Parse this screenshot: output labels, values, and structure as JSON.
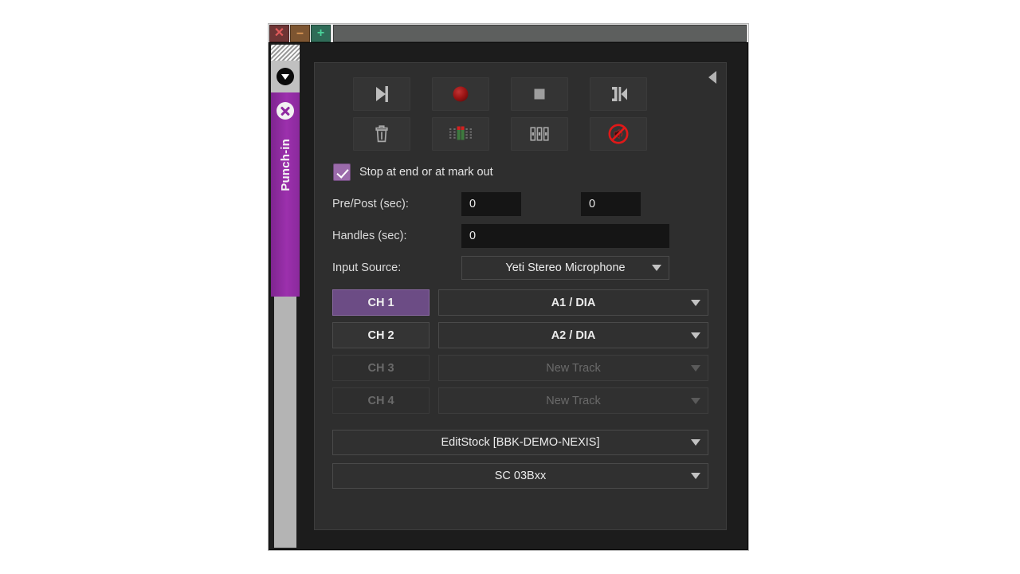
{
  "window": {
    "titlebar": {
      "close_label": "✕",
      "minimize_label": "–",
      "maximize_label": "+"
    }
  },
  "rail": {
    "caret_icon": "chevron-down-icon",
    "tab": {
      "label": "Punch-in",
      "close_icon": "close-circle-icon"
    }
  },
  "panel": {
    "collapse_icon": "collapse-left-arrow-icon",
    "toolbar": [
      {
        "name": "play-to-mark-button",
        "icon": "play-mark-icon"
      },
      {
        "name": "record-button",
        "icon": "record-circle-icon"
      },
      {
        "name": "stop-button",
        "icon": "stop-square-icon"
      },
      {
        "name": "punch-in-mark-button",
        "icon": "mark-in-bracket-icon"
      },
      {
        "name": "delete-button",
        "icon": "trash-icon"
      },
      {
        "name": "audio-meters-button",
        "icon": "audio-meter-icon"
      },
      {
        "name": "faders-button",
        "icon": "fader-bars-icon"
      },
      {
        "name": "mute-button",
        "icon": "mute-slash-icon"
      }
    ],
    "stop_at_end": {
      "label": "Stop at end or at mark out",
      "checked": true
    },
    "prepost": {
      "label": "Pre/Post (sec):",
      "value_pre": "0",
      "value_post": "0"
    },
    "handles": {
      "label": "Handles (sec):",
      "value": "0"
    },
    "input_source": {
      "label": "Input Source:",
      "value": "Yeti Stereo Microphone"
    },
    "channels": [
      {
        "name": "CH 1",
        "track": "A1 / DIA",
        "active": true,
        "enabled": true
      },
      {
        "name": "CH 2",
        "track": "A2 / DIA",
        "active": false,
        "enabled": true
      },
      {
        "name": "CH 3",
        "track": "New Track",
        "active": false,
        "enabled": false
      },
      {
        "name": "CH 4",
        "track": "New Track",
        "active": false,
        "enabled": false
      }
    ],
    "target_volume": "EditStock [BBK-DEMO-NEXIS]",
    "target_bin": "SC 03Bxx"
  },
  "colors": {
    "accent_purple": "#8f2aa0",
    "channel_active": "#6c4c85",
    "record_red": "#a01414",
    "mute_red": "#e01818",
    "meter_green": "#3e7a3e",
    "panel_bg": "#2e2e2e",
    "field_bg": "#151515"
  }
}
